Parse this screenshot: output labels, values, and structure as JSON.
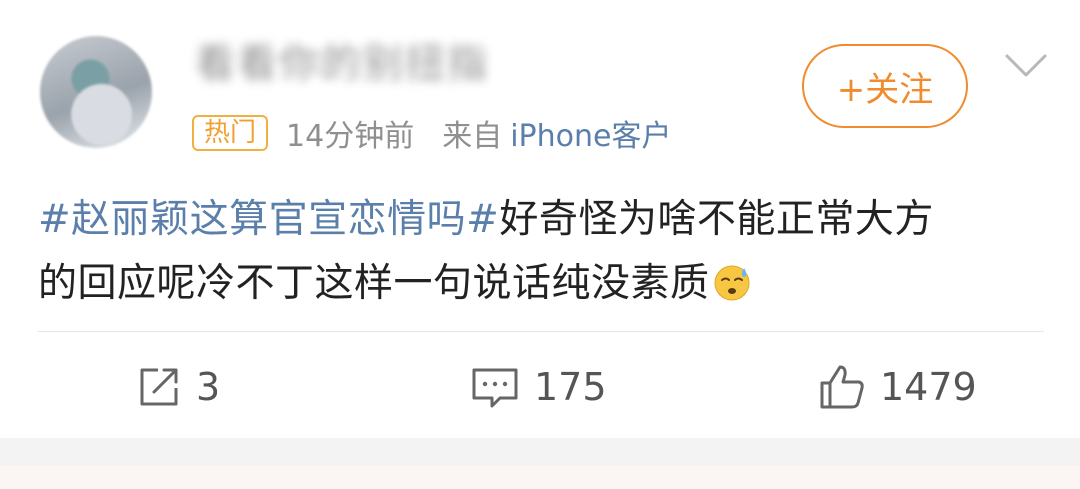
{
  "post": {
    "username": "看看你的别扭指",
    "hot_badge": "热门",
    "time": "14分钟前",
    "source_prefix": "来自",
    "source": "iPhone客户",
    "follow_label": "+关注",
    "hashtag": "#赵丽颖这算官宣恋情吗#",
    "text_line1_rest": "好奇怪为啥不能正常大方",
    "text_line2": "的回应呢冷不丁这样一句说话纯没素质",
    "emoji_name": "sweat-emoji"
  },
  "actions": {
    "repost_count": "3",
    "comment_count": "175",
    "like_count": "1479"
  },
  "colors": {
    "accent_orange": "#f08b2e",
    "hashtag_blue": "#5b7fab",
    "badge_orange": "#f0a030"
  }
}
